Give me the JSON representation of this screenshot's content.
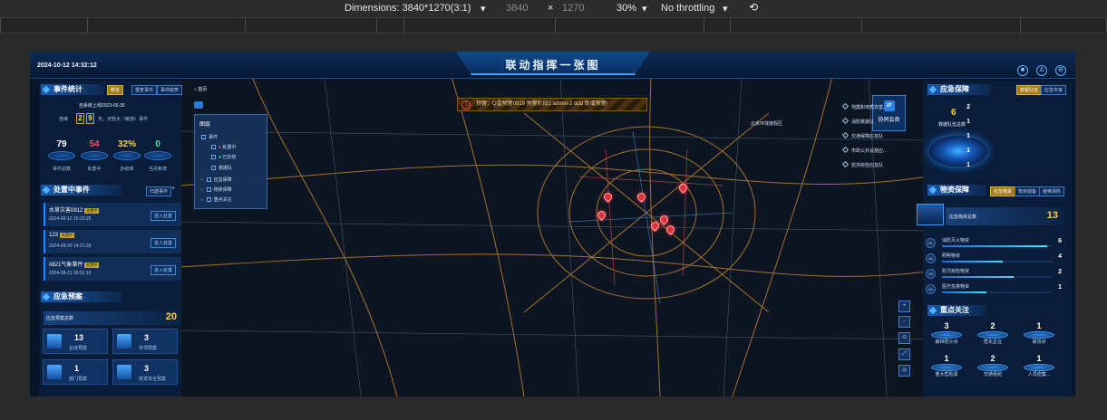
{
  "devtools": {
    "dimensions_label": "Dimensions: 3840*1270(3:1)",
    "width": "3840",
    "times": "×",
    "height": "1270",
    "zoom": "30%",
    "throttle": "No throttling",
    "rotate_icon": "rotate-icon"
  },
  "header": {
    "datetime": "2024-10-12 14:32:12",
    "title": "联动指挥一张图",
    "icons": [
      "notification-icon",
      "user-icon",
      "settings-icon"
    ]
  },
  "event_stats": {
    "title": "事件统计",
    "tabs": [
      "概览",
      "重复事件",
      "事件趋势"
    ],
    "since": "自系统上线2023-05-30",
    "streak_prefix": "连续",
    "streak_digits": [
      "2",
      "9"
    ],
    "streak_suffix": "天，无较大（敏感）事件",
    "stats": [
      {
        "value": "79",
        "label": "事件总数",
        "color": "#ffffff"
      },
      {
        "value": "54",
        "label": "处置中",
        "color": "#ff4d5a"
      },
      {
        "value": "32%",
        "label": "办结率",
        "color": "#ffd23a"
      },
      {
        "value": "0",
        "label": "当月新增",
        "color": "#3cf0a0"
      }
    ]
  },
  "in_progress": {
    "title": "处置中事件",
    "tab": "归建事件",
    "items": [
      {
        "name": "水草灾害0912",
        "badge": "处置中",
        "time": "2024-09-12 15:16:25",
        "button": "进入处置"
      },
      {
        "name": "123",
        "badge": "处置中",
        "time": "2024-08-30 14:21:28",
        "button": "进入处置"
      },
      {
        "name": "0821气象事件",
        "badge": "处置中",
        "time": "2024-08-21 09:52:19",
        "button": "进入处置"
      }
    ]
  },
  "emergency_plans": {
    "title": "应急预案",
    "total_label": "应急预案总数",
    "total_value": "20",
    "cards": [
      {
        "value": "13",
        "label": "总体预案"
      },
      {
        "value": "3",
        "label": "专项预案"
      },
      {
        "value": "1",
        "label": "部门预案"
      },
      {
        "value": "3",
        "label": "突发安全预案"
      }
    ]
  },
  "map": {
    "home_label": "首页",
    "alert_text": "预警：Q雷预警0919  预警阶段1  admin-2  ddd  新增预警!",
    "layers": {
      "title": "图层",
      "items": [
        "事件",
        "处置中",
        "已办结",
        "救援队",
        "应急保障",
        "物资保障",
        "重点关注"
      ]
    },
    "cowork_label": "协同会商",
    "tools": [
      "+",
      "-",
      "⊙",
      "⤢",
      "◎"
    ],
    "district_label": "北京环球度假区"
  },
  "rescue": {
    "title": "应急保障",
    "tabs": [
      "救援队伍",
      "应急专家"
    ],
    "total_value": "6",
    "total_label": "救援队伍总数",
    "items": [
      {
        "label": "地震和地质灾害...",
        "value": "2"
      },
      {
        "label": "消防救援队",
        "value": "1"
      },
      {
        "label": "交通保障应急队",
        "value": "1"
      },
      {
        "label": "市政公共设施应...",
        "value": "1"
      },
      {
        "label": "抗洪抢险应急队",
        "value": "1"
      }
    ]
  },
  "materials": {
    "title": "物资保障",
    "tabs": [
      "应急物资",
      "物资储备",
      "避难场所"
    ],
    "total_label": "应急物资总数",
    "total_value": "13",
    "items": [
      {
        "code": "01",
        "label": "消防灭火物资",
        "value": "6",
        "ratio": 0.95
      },
      {
        "code": "02",
        "label": "照明物资",
        "value": "4",
        "ratio": 0.55
      },
      {
        "code": "03",
        "label": "防汛抢险物资",
        "value": "2",
        "ratio": 0.65
      },
      {
        "code": "04",
        "label": "医疗急救物资",
        "value": "1",
        "ratio": 0.4
      }
    ]
  },
  "focus": {
    "title": "重点关注",
    "items": [
      {
        "value": "3",
        "label": "森林防火点"
      },
      {
        "value": "2",
        "label": "危化企业"
      },
      {
        "value": "1",
        "label": "易涝点"
      },
      {
        "value": "1",
        "label": "重大危险源"
      },
      {
        "value": "2",
        "label": "交通枢纽"
      },
      {
        "value": "1",
        "label": "人员密集..."
      }
    ]
  }
}
